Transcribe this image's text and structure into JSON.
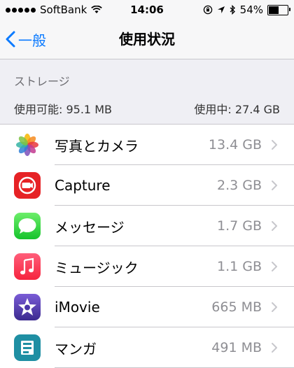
{
  "status_bar": {
    "carrier": "SoftBank",
    "time": "14:06",
    "battery_percent_text": "54%",
    "battery_level": 0.54
  },
  "nav": {
    "back_label": "一般",
    "title": "使用状況"
  },
  "storage": {
    "section_label": "ストレージ",
    "available": "使用可能: 95.1 MB",
    "used": "使用中: 27.4 GB"
  },
  "apps": [
    {
      "name": "写真とカメラ",
      "size": "13.4 GB",
      "icon": "photos-icon"
    },
    {
      "name": "Capture",
      "size": "2.3 GB",
      "icon": "capture-icon"
    },
    {
      "name": "メッセージ",
      "size": "1.7 GB",
      "icon": "messages-icon"
    },
    {
      "name": "ミュージック",
      "size": "1.1 GB",
      "icon": "music-icon"
    },
    {
      "name": "iMovie",
      "size": "665 MB",
      "icon": "imovie-icon"
    },
    {
      "name": "マンガ",
      "size": "491 MB",
      "icon": "manga-icon"
    }
  ],
  "colors": {
    "accent": "#0a7aff",
    "background": "#efeff4"
  }
}
